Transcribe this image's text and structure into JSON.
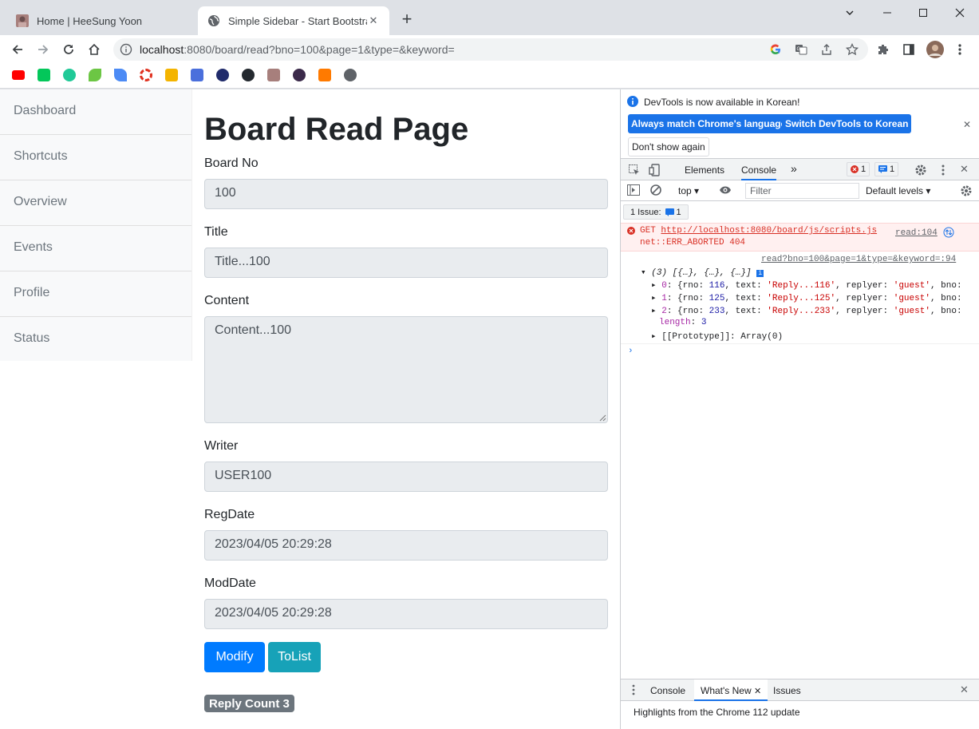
{
  "browser": {
    "tabs": [
      {
        "title": "Home | HeeSung Yoon",
        "active": false
      },
      {
        "title": "Simple Sidebar - Start Bootstrap",
        "active": true
      }
    ],
    "url_host": "localhost",
    "url_rest": ":8080/board/read?bno=100&page=1&type=&keyword="
  },
  "sidebar": {
    "items": [
      "Dashboard",
      "Shortcuts",
      "Overview",
      "Events",
      "Profile",
      "Status"
    ]
  },
  "page": {
    "title": "Board Read Page",
    "fields": [
      {
        "label": "Board No",
        "value": "100"
      },
      {
        "label": "Title",
        "value": "Title...100"
      },
      {
        "label": "Content",
        "value": "Content...100"
      },
      {
        "label": "Writer",
        "value": "USER100"
      },
      {
        "label": "RegDate",
        "value": "2023/04/05 20:29:28"
      },
      {
        "label": "ModDate",
        "value": "2023/04/05 20:29:28"
      }
    ],
    "modify_label": "Modify",
    "tolist_label": "ToList",
    "reply_badge": "Reply Count 3"
  },
  "colors": {
    "primary": "#007bff",
    "info": "#17a2b8",
    "secondary": "#6c757d",
    "devtools_blue": "#1a73e8"
  },
  "devtools": {
    "info_message": "DevTools is now available in Korean!",
    "btn_match": "Always match Chrome's language",
    "btn_switch": "Switch DevTools to Korean",
    "btn_dont": "Don't show again",
    "tab_elements": "Elements",
    "tab_console": "Console",
    "error_badge": "1",
    "message_badge": "1",
    "context": "top",
    "filter_placeholder": "Filter",
    "levels": "Default levels",
    "issues": "1 Issue:",
    "issues_count": "1",
    "error_line1_method": "GET",
    "error_line1_url": "http://localhost:8080/board/js/scripts.js",
    "error_line2": "net::ERR_ABORTED 404",
    "error_source": "read:104",
    "log_source": "read?bno=100&page=1&type=&keyword=:94",
    "log_head": "(3) [{…}, {…}, {…}]",
    "entries": [
      {
        "index": "0",
        "rno": "116",
        "text": "'Reply...116'",
        "replyer": "'guest'"
      },
      {
        "index": "1",
        "rno": "125",
        "text": "'Reply...125'",
        "replyer": "'guest'"
      },
      {
        "index": "2",
        "rno": "233",
        "text": "'Reply...233'",
        "replyer": "'guest'"
      }
    ],
    "length_key": "length",
    "length_value": "3",
    "prototype": "[[Prototype]]: Array(0)",
    "drawer_console": "Console",
    "drawer_whatsnew": "What's New",
    "drawer_issues": "Issues",
    "highlights": "Highlights from the Chrome 112 update"
  }
}
